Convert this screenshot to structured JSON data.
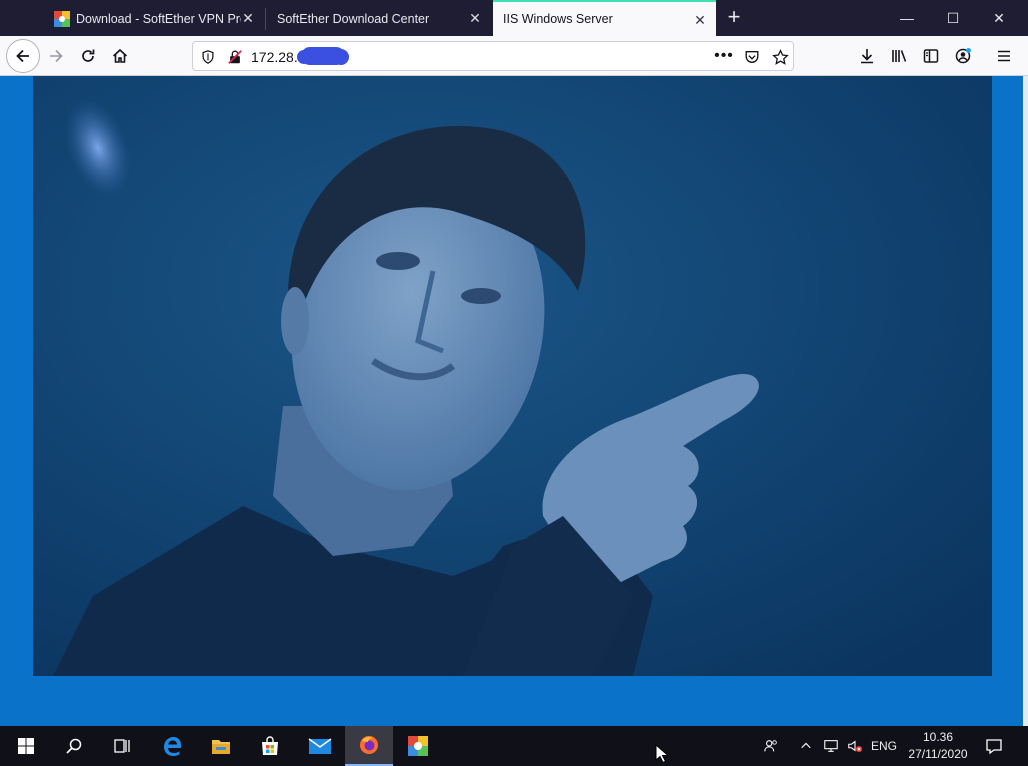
{
  "browser": {
    "tabs": [
      {
        "label": "Download - SoftEther VPN Proj",
        "active": false
      },
      {
        "label": "SoftEther Download Center",
        "active": false
      },
      {
        "label": "IIS Windows Server",
        "active": true
      }
    ],
    "tab_close_glyph": "✕",
    "new_tab_glyph": "+",
    "window_controls": {
      "minimize": "—",
      "maximize": "☐",
      "close": "✕"
    },
    "url": "172.28.",
    "accent_color": "#3fe1b0"
  },
  "page": {
    "background_color": "#0a72c9",
    "image_description_name": "photo-of-man-pointing"
  },
  "taskbar": {
    "pinned": [
      "start-icon",
      "search-icon",
      "task-view-icon",
      "edge-icon",
      "file-explorer-icon",
      "store-icon",
      "mail-icon",
      "firefox-icon",
      "softether-icon"
    ],
    "language": "ENG",
    "time": "10.36",
    "date": "27/11/2020"
  }
}
